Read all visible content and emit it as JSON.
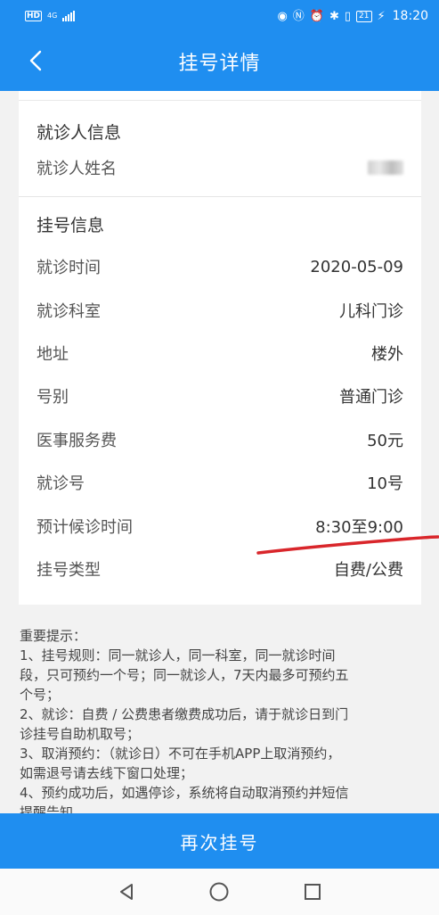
{
  "status_bar": {
    "hd": "HD",
    "network": "4G",
    "battery": "21",
    "time": "18:20"
  },
  "header": {
    "title": "挂号详情",
    "back_icon": "chevron-left-icon"
  },
  "patient_section": {
    "title": "就诊人信息",
    "name_label": "就诊人姓名"
  },
  "registration_section": {
    "title": "挂号信息",
    "rows": [
      {
        "label": "就诊时间",
        "value": "2020-05-09"
      },
      {
        "label": "就诊科室",
        "value": "儿科门诊"
      },
      {
        "label": "地址",
        "value": "楼外"
      },
      {
        "label": "号别",
        "value": "普通门诊"
      },
      {
        "label": "医事服务费",
        "value": "50元"
      },
      {
        "label": "就诊号",
        "value": "10号"
      },
      {
        "label": "预计候诊时间",
        "value": "8:30至9:00"
      },
      {
        "label": "挂号类型",
        "value": "自费/公费"
      }
    ]
  },
  "notice": {
    "title": "重要提示：",
    "lines": [
      "1、挂号规则：同一就诊人，同一科室，同一就诊时间",
      "段，只可预约一个号；同一就诊人，7天内最多可预约五",
      "个号；",
      "2、就诊：自费 / 公费患者缴费成功后，请于就诊日到门",
      "诊挂号自助机取号；",
      "3、取消预约：（就诊日）不可在手机APP上取消预约，",
      "如需退号请去线下窗口处理；",
      "4、预约成功后，如遇停诊，系统将自动取消预约并短信",
      "提醒告知。"
    ]
  },
  "actions": {
    "rebook_label": "再次挂号"
  },
  "colors": {
    "primary": "#1f8ef0",
    "annotation": "#d9262b"
  }
}
